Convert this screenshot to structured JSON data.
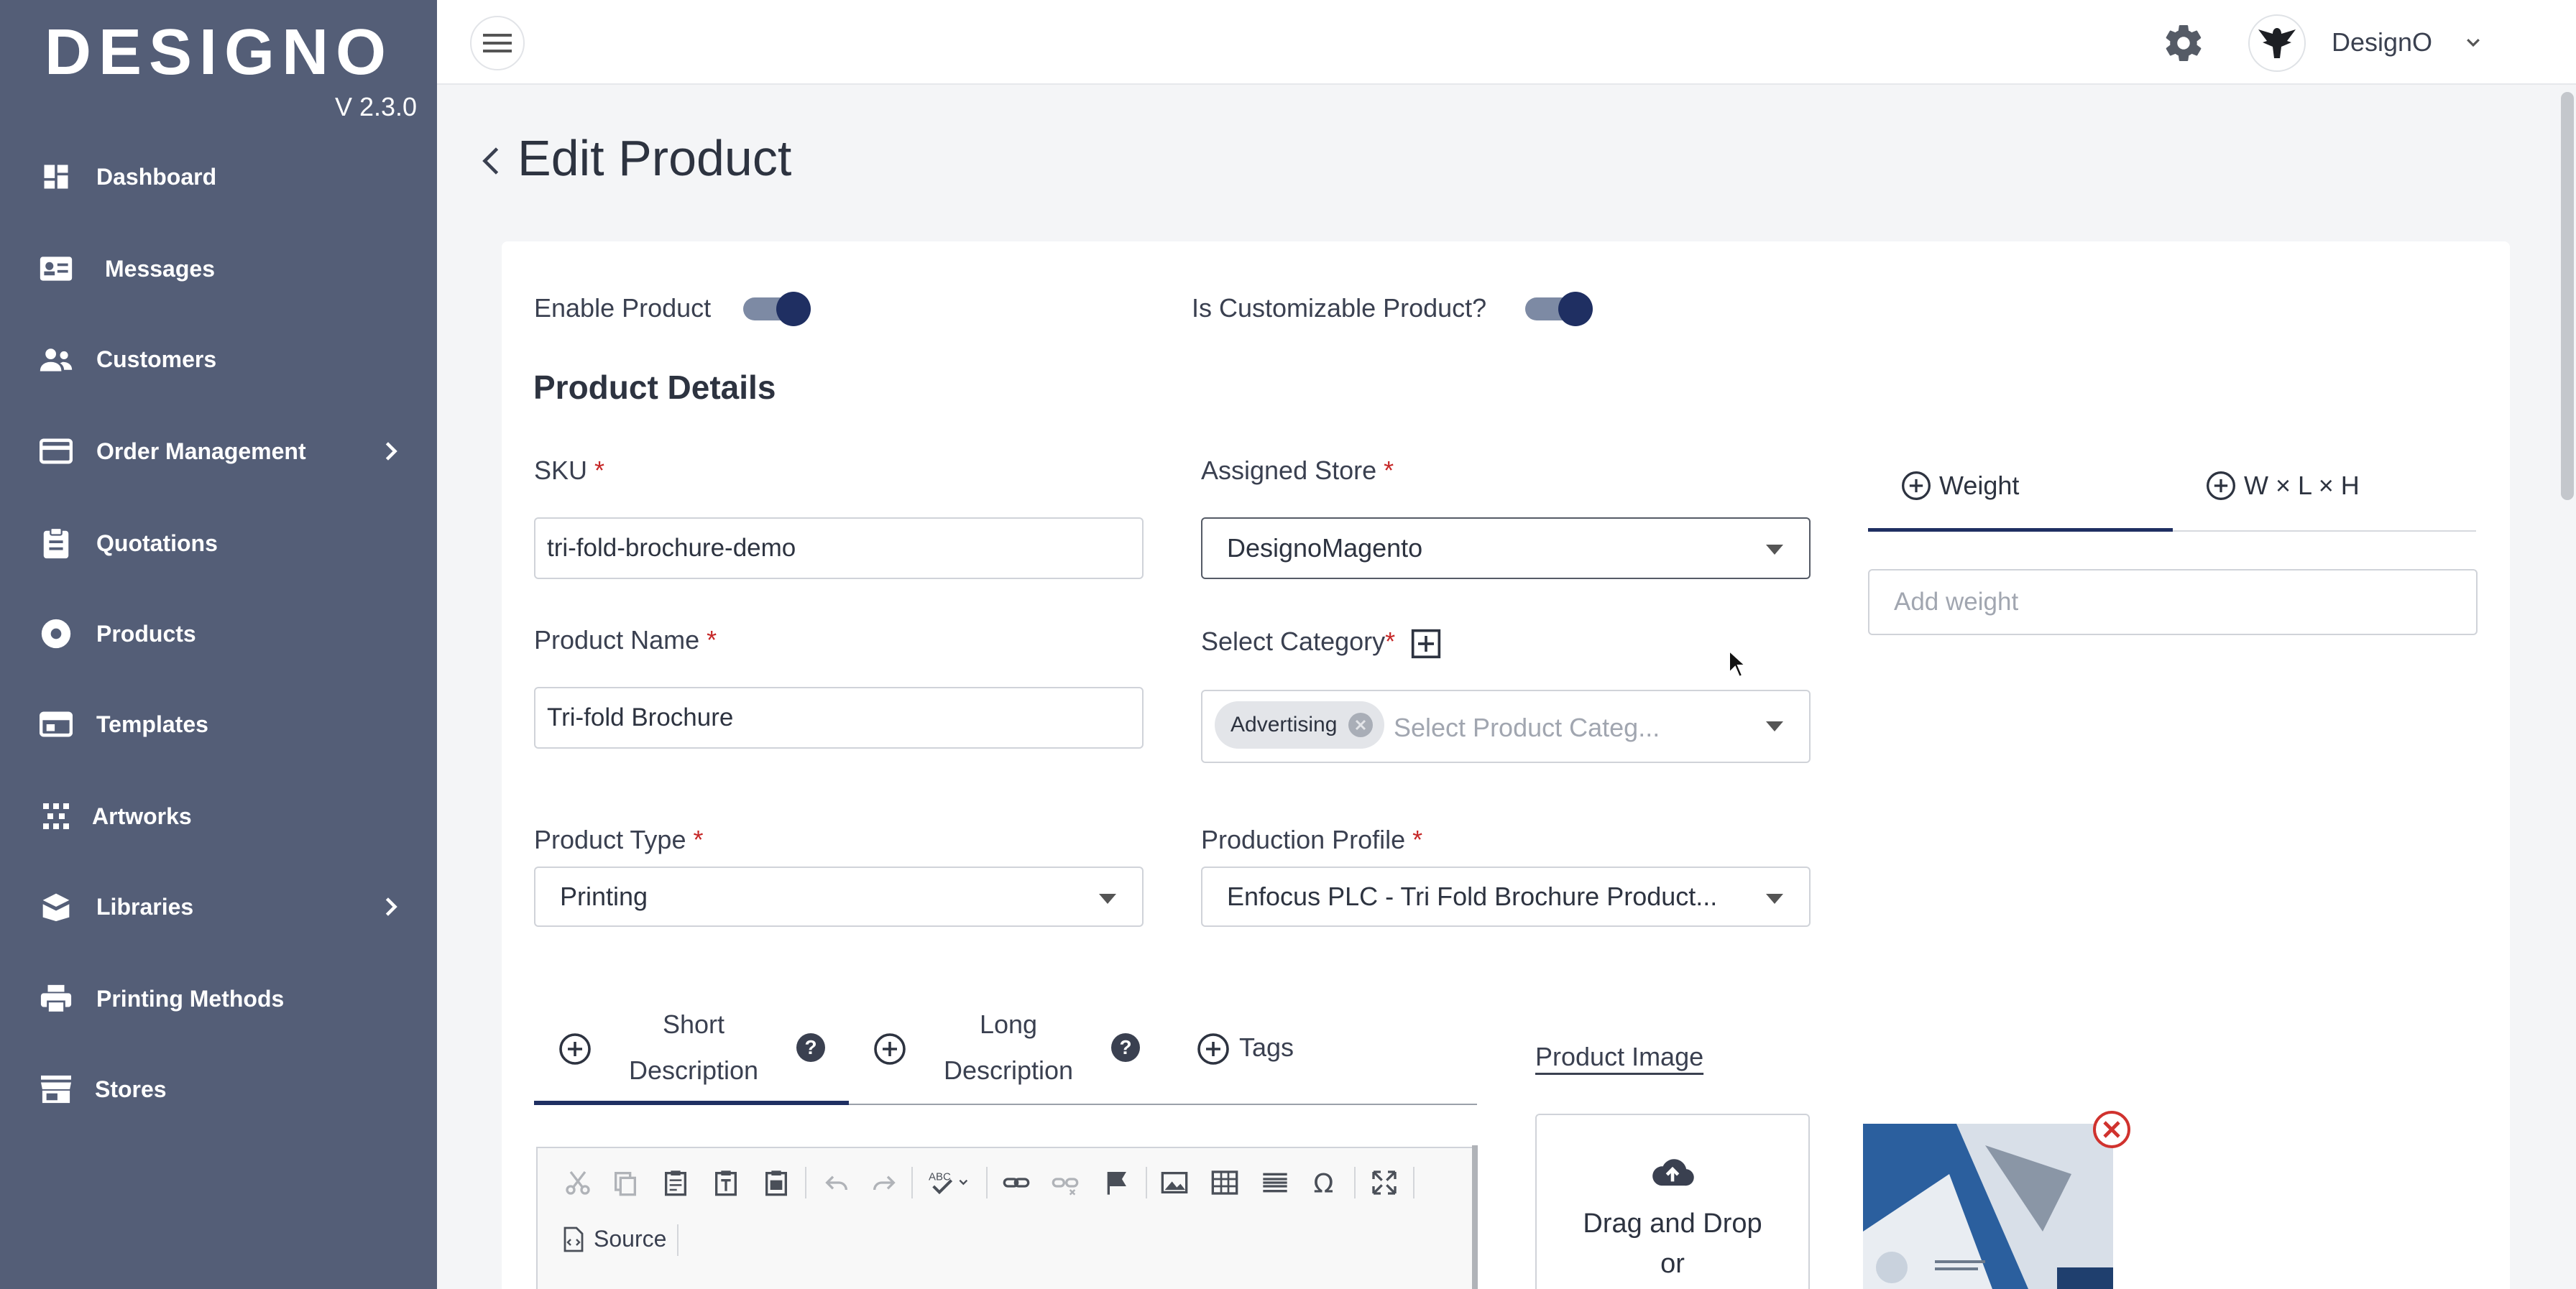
{
  "app": {
    "brand": "DESIGNO",
    "version": "V 2.3.0"
  },
  "sidebar": {
    "items": [
      {
        "label": "Dashboard",
        "icon": "dashboard-icon"
      },
      {
        "label": "Messages",
        "icon": "messages-icon"
      },
      {
        "label": "Customers",
        "icon": "customers-icon"
      },
      {
        "label": "Order Management",
        "icon": "order-icon",
        "has_submenu": true
      },
      {
        "label": "Quotations",
        "icon": "quotations-icon"
      },
      {
        "label": "Products",
        "icon": "products-icon"
      },
      {
        "label": "Templates",
        "icon": "templates-icon"
      },
      {
        "label": "Artworks",
        "icon": "artworks-icon"
      },
      {
        "label": "Libraries",
        "icon": "libraries-icon",
        "has_submenu": true
      },
      {
        "label": "Printing Methods",
        "icon": "printer-icon"
      },
      {
        "label": "Stores",
        "icon": "store-icon"
      }
    ]
  },
  "topbar": {
    "user_name": "DesignO"
  },
  "page": {
    "title": "Edit Product"
  },
  "form": {
    "enable_product_label": "Enable Product",
    "customizable_label": "Is Customizable Product?",
    "section_title": "Product Details",
    "sku": {
      "label": "SKU",
      "value": "tri-fold-brochure-demo"
    },
    "assigned_store": {
      "label": "Assigned Store",
      "value": "DesignoMagento"
    },
    "product_name": {
      "label": "Product Name",
      "value": "Tri-fold Brochure"
    },
    "category": {
      "label": "Select Category",
      "chip": "Advertising",
      "placeholder": "Select Product Categ..."
    },
    "product_type": {
      "label": "Product Type",
      "value": "Printing"
    },
    "production_profile": {
      "label": "Production Profile",
      "value": "Enfocus PLC - Tri Fold Brochure Product..."
    },
    "required_mark": "*"
  },
  "dimensions": {
    "tab_weight": "Weight",
    "tab_wlh": "W × L × H",
    "weight_placeholder": "Add weight"
  },
  "description_tabs": {
    "short_line1": "Short",
    "short_line2": "Description",
    "long_line1": "Long",
    "long_line2": "Description",
    "tags": "Tags",
    "help_glyph": "?"
  },
  "editor": {
    "source_label": "Source"
  },
  "product_image": {
    "title": "Product Image",
    "drop_line1": "Drag and Drop",
    "drop_line2": "or"
  },
  "colors": {
    "sidebar": "#545e77",
    "toggle_knob": "#1f2f62",
    "required": "#c62828"
  }
}
